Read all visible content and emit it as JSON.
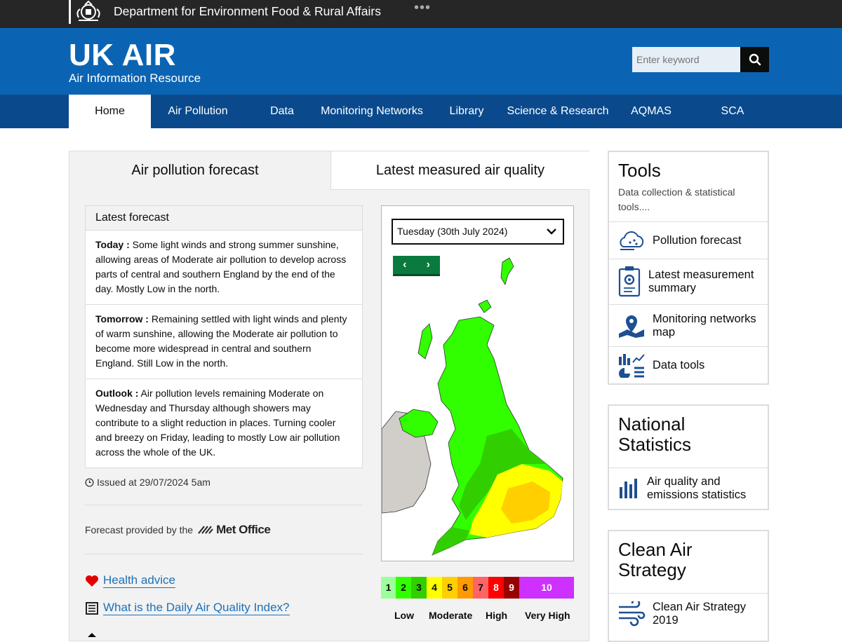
{
  "gov_bar": {
    "department": "Department for Environment Food & Rural Affairs",
    "menu_dots": "•••"
  },
  "masthead": {
    "title": "UK AIR",
    "subtitle": "Air Information Resource",
    "search_placeholder": "Enter keyword"
  },
  "nav": {
    "items": [
      "Home",
      "Air Pollution",
      "Data",
      "Monitoring Networks",
      "Library",
      "Science & Research",
      "AQMAS",
      "SCA"
    ]
  },
  "tabs": {
    "forecast": "Air pollution forecast",
    "latest": "Latest measured air quality"
  },
  "forecast": {
    "heading": "Latest forecast",
    "today_label": "Today :",
    "today_text": " Some light winds and strong summer sunshine, allowing areas of Moderate air pollution to develop across parts of central and southern England by the end of the day. Mostly Low in the north.",
    "tomorrow_label": "Tomorrow :",
    "tomorrow_text": " Remaining settled with light winds and plenty of warm sunshine, allowing the Moderate air pollution to become more widespread in central and southern England. Still Low in the north.",
    "outlook_label": "Outlook :",
    "outlook_text": " Air pollution levels remaining Moderate on Wednesday and Thursday although showers may contribute to a slight reduction in places. Turning cooler and breezy on Friday, leading to mostly Low air pollution across the whole of the UK.",
    "issued": "Issued at 29/07/2024 5am",
    "provided_by": "Forecast provided by the",
    "met_office": "Met Office"
  },
  "links": {
    "health": "Health advice",
    "daqi": "What is the Daily Air Quality Index?"
  },
  "map": {
    "selected_day": "Tuesday (30th July 2024)",
    "prev": "‹",
    "next": "›"
  },
  "daqi_scale": {
    "bands": [
      {
        "label": "1",
        "color": "#9cff9c"
      },
      {
        "label": "2",
        "color": "#31ff00"
      },
      {
        "label": "3",
        "color": "#31cf00"
      },
      {
        "label": "4",
        "color": "#ffff00"
      },
      {
        "label": "5",
        "color": "#ffcf00"
      },
      {
        "label": "6",
        "color": "#ff9a00"
      },
      {
        "label": "7",
        "color": "#ff6464"
      },
      {
        "label": "8",
        "color": "#ff0000"
      },
      {
        "label": "9",
        "color": "#990000"
      },
      {
        "label": "10",
        "color": "#ce30ff"
      }
    ],
    "levels": [
      "Low",
      "Moderate",
      "High",
      "Very High"
    ]
  },
  "tools": {
    "title": "Tools",
    "desc": "Data collection & statistical tools....",
    "items": [
      "Pollution forecast",
      "Latest measurement summary",
      "Monitoring networks map",
      "Data tools"
    ]
  },
  "national_stats": {
    "title": "National Statistics",
    "item": "Air quality and emissions statistics"
  },
  "clean_air": {
    "title": "Clean Air Strategy",
    "item": "Clean Air Strategy 2019"
  }
}
